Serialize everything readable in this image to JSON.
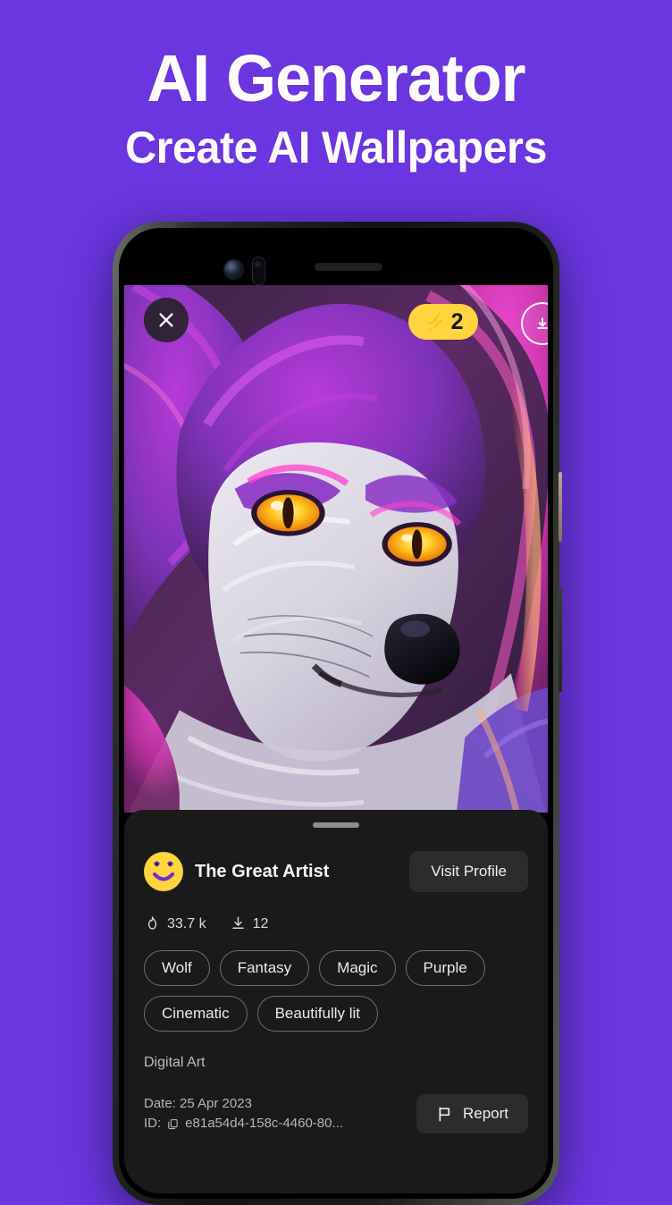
{
  "promo": {
    "title": "AI Generator",
    "subtitle": "Create AI Wallpapers",
    "background_color": "#6b35df",
    "text_color": "#fdfcfa"
  },
  "overlay": {
    "close_icon": "close-icon",
    "credits": {
      "icon": "lightning-bolt-icon",
      "value": "2",
      "badge_color": "#ffd43f"
    },
    "info_icon": "download-circle-icon"
  },
  "artwork": {
    "subject": "purple magenta wolf portrait with glowing amber eyes",
    "alt": "AI generated wolf wallpaper"
  },
  "sheet": {
    "author": {
      "avatar_icon": "smiley-avatar",
      "name": "The Great Artist",
      "visit_label": "Visit Profile"
    },
    "stats": [
      {
        "icon": "flame-icon",
        "value": "33.7 k"
      },
      {
        "icon": "download-icon",
        "value": "12"
      }
    ],
    "tags": [
      "Wolf",
      "Fantasy",
      "Magic",
      "Purple",
      "Cinematic",
      "Beautifully lit"
    ],
    "category": "Digital Art",
    "meta": {
      "date_label": "Date: 25 Apr 2023",
      "id_label": "ID:",
      "id_value": "e81a54d4-158c-4460-80...",
      "copy_icon": "copy-icon"
    },
    "report": {
      "icon": "flag-icon",
      "label": "Report"
    }
  }
}
